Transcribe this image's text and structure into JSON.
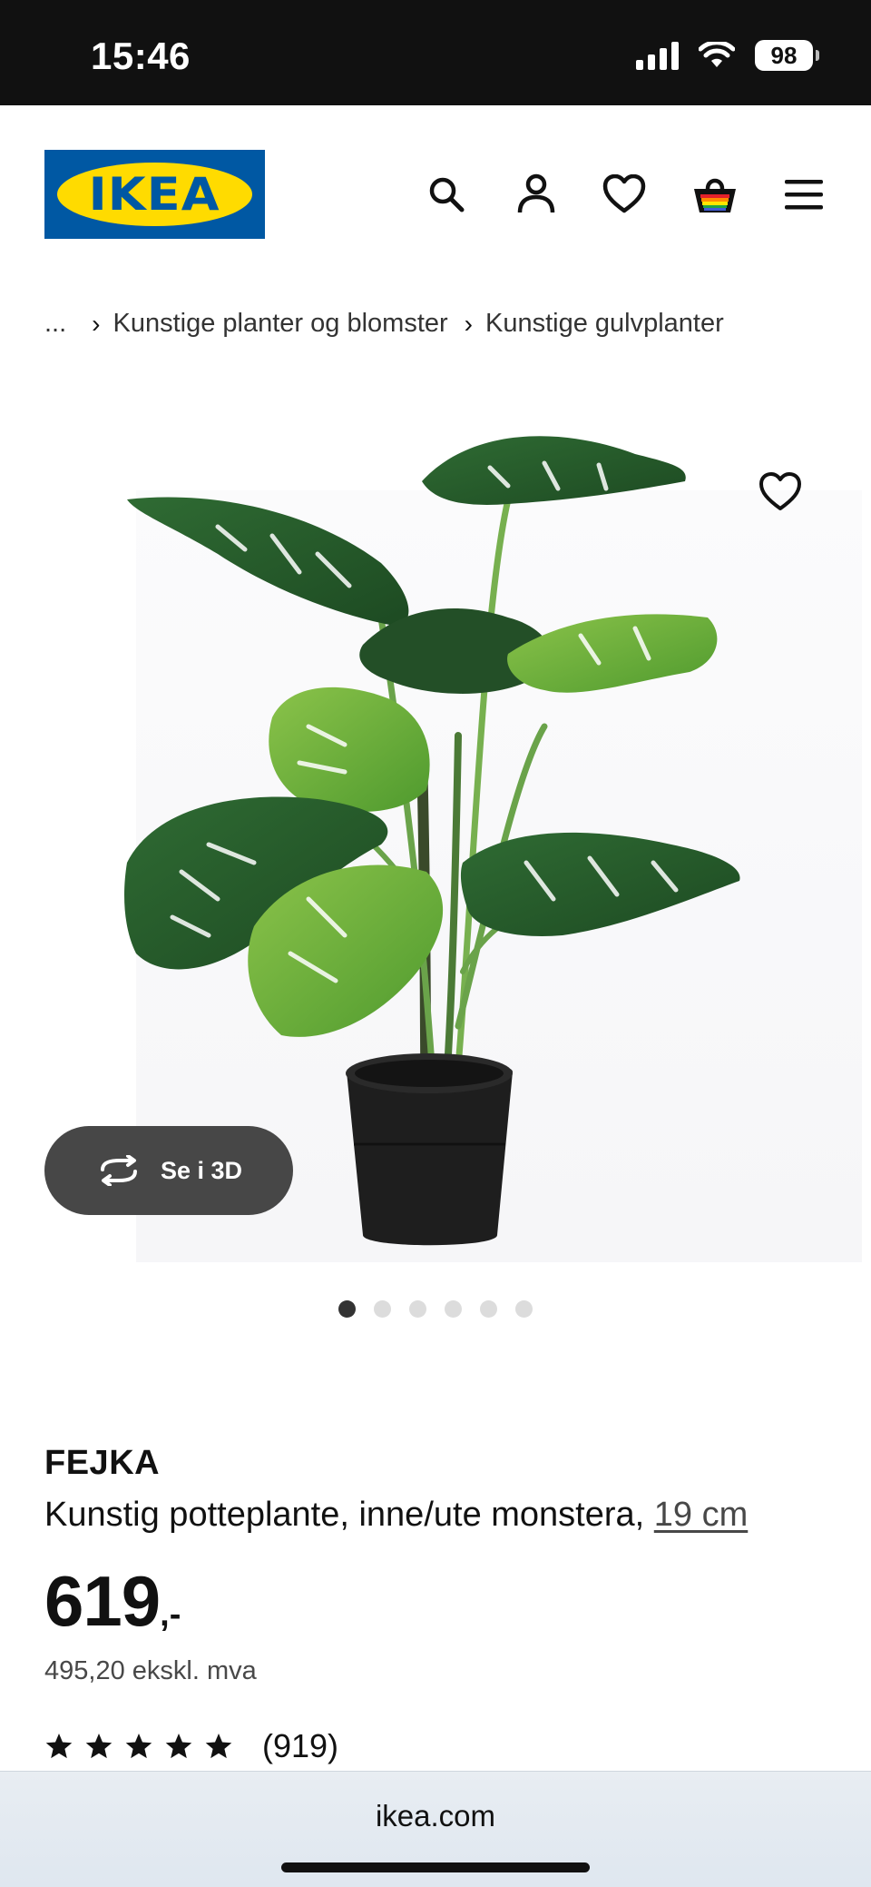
{
  "status_bar": {
    "time": "15:46",
    "battery": "98"
  },
  "header": {
    "logo_text": "IKEA",
    "icons": [
      "search-icon",
      "account-icon",
      "favourites-icon",
      "cart-icon",
      "menu-icon"
    ]
  },
  "breadcrumb": {
    "ellipsis": "...",
    "items": [
      "Kunstige planter og blomster",
      "Kunstige gulvplanter"
    ]
  },
  "gallery": {
    "view_3d_label": "Se i 3D",
    "image_count": 6,
    "active_index": 0
  },
  "product": {
    "brand": "FEJKA",
    "description": "Kunstig potteplante, inne/ute monstera, ",
    "size": "19 cm",
    "price_integer": "619",
    "price_suffix": ",-",
    "price_ex_vat": "495,20 ekskl. mva",
    "rating_stars": 5,
    "review_count": "(919)"
  },
  "browser": {
    "url": "ikea.com"
  },
  "colors": {
    "ikea_blue": "#0058a3",
    "ikea_yellow": "#ffdb00",
    "button_3d": "#474747"
  }
}
